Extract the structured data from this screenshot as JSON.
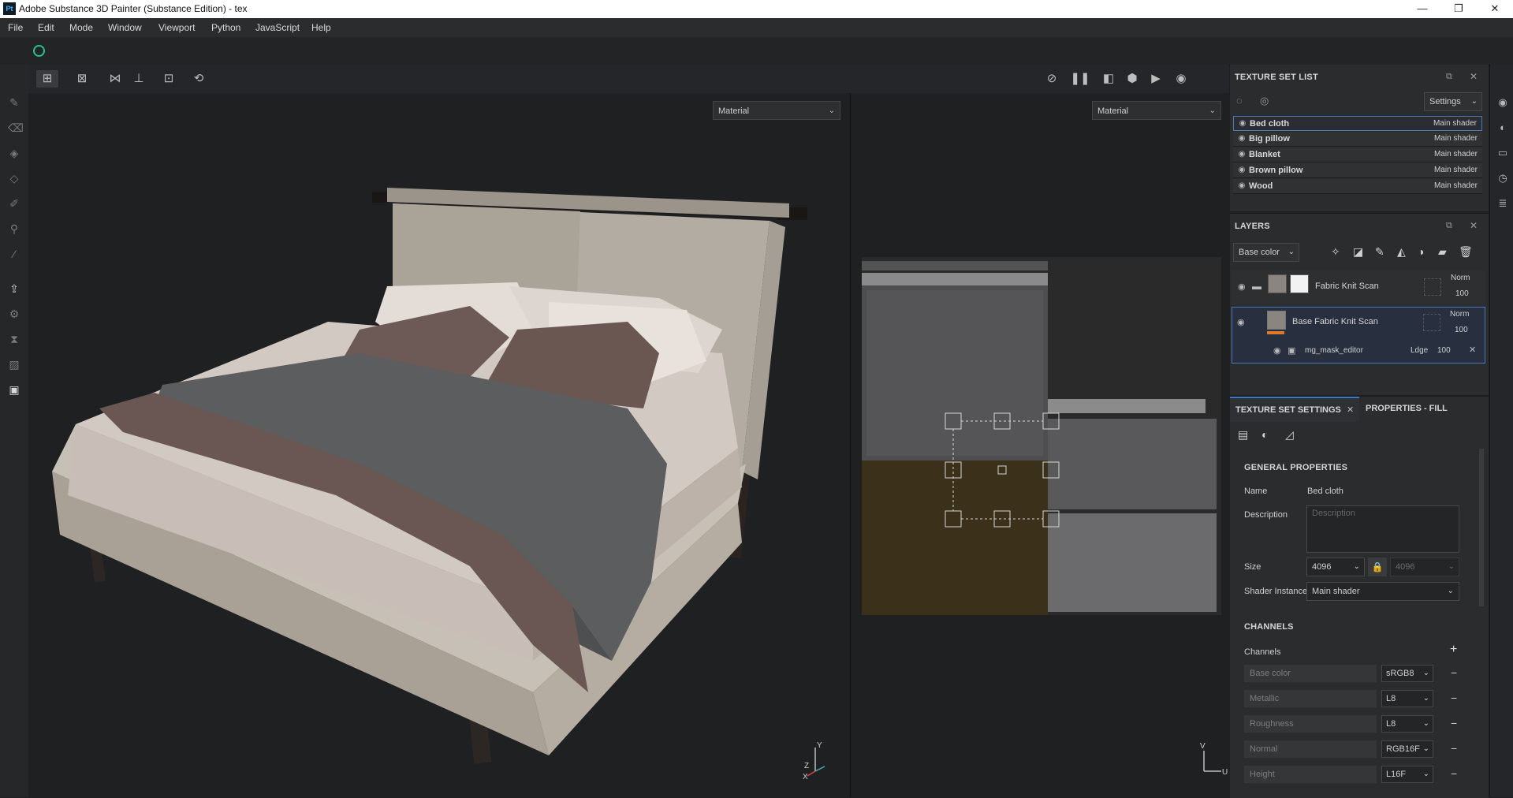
{
  "window": {
    "logo_text": "Pt",
    "title": "Adobe Substance 3D Painter (Substance Edition) - tex",
    "minimize_icon": "—",
    "restore_icon": "❐",
    "close_icon": "✕"
  },
  "menu": [
    "File",
    "Edit",
    "Mode",
    "Window",
    "Viewport",
    "Python",
    "JavaScript",
    "Help"
  ],
  "viewport": {
    "left_mode": "Material",
    "right_mode": "Material",
    "axis_y": "Y",
    "axis_z": "Z",
    "axis_x": "X",
    "uv_axis_v": "V",
    "uv_axis_u": "U"
  },
  "texture_set_list": {
    "title": "TEXTURE SET LIST",
    "settings_label": "Settings",
    "items": [
      {
        "name": "Bed cloth",
        "shader": "Main shader",
        "selected": true
      },
      {
        "name": "Big pillow",
        "shader": "Main shader",
        "selected": false
      },
      {
        "name": "Blanket",
        "shader": "Main shader",
        "selected": false
      },
      {
        "name": "Brown pillow",
        "shader": "Main shader",
        "selected": false
      },
      {
        "name": "Wood",
        "shader": "Main shader",
        "selected": false
      }
    ]
  },
  "layers": {
    "title": "LAYERS",
    "channel_select": "Base color",
    "items": [
      {
        "name": "Fabric Knit Scan",
        "blend": "Norm",
        "opacity": "100"
      },
      {
        "name": "Base Fabric Knit Scan",
        "blend": "Norm",
        "opacity": "100"
      }
    ],
    "effect": {
      "name": "mg_mask_editor",
      "blend": "Ldge",
      "opacity": "100"
    }
  },
  "tabs": {
    "texture_set_settings": "TEXTURE SET SETTINGS",
    "properties_fill": "PROPERTIES - FILL"
  },
  "general": {
    "heading": "GENERAL PROPERTIES",
    "name_label": "Name",
    "name_value": "Bed cloth",
    "description_label": "Description",
    "description_placeholder": "Description",
    "size_label": "Size",
    "size_value": "4096",
    "size_value_locked": "4096",
    "shader_label": "Shader Instance",
    "shader_value": "Main shader"
  },
  "channels": {
    "heading": "CHANNELS",
    "label": "Channels",
    "add_icon": "+",
    "items": [
      {
        "name": "Base color",
        "format": "sRGB8"
      },
      {
        "name": "Metallic",
        "format": "L8"
      },
      {
        "name": "Roughness",
        "format": "L8"
      },
      {
        "name": "Normal",
        "format": "RGB16F"
      },
      {
        "name": "Height",
        "format": "L16F"
      }
    ]
  }
}
